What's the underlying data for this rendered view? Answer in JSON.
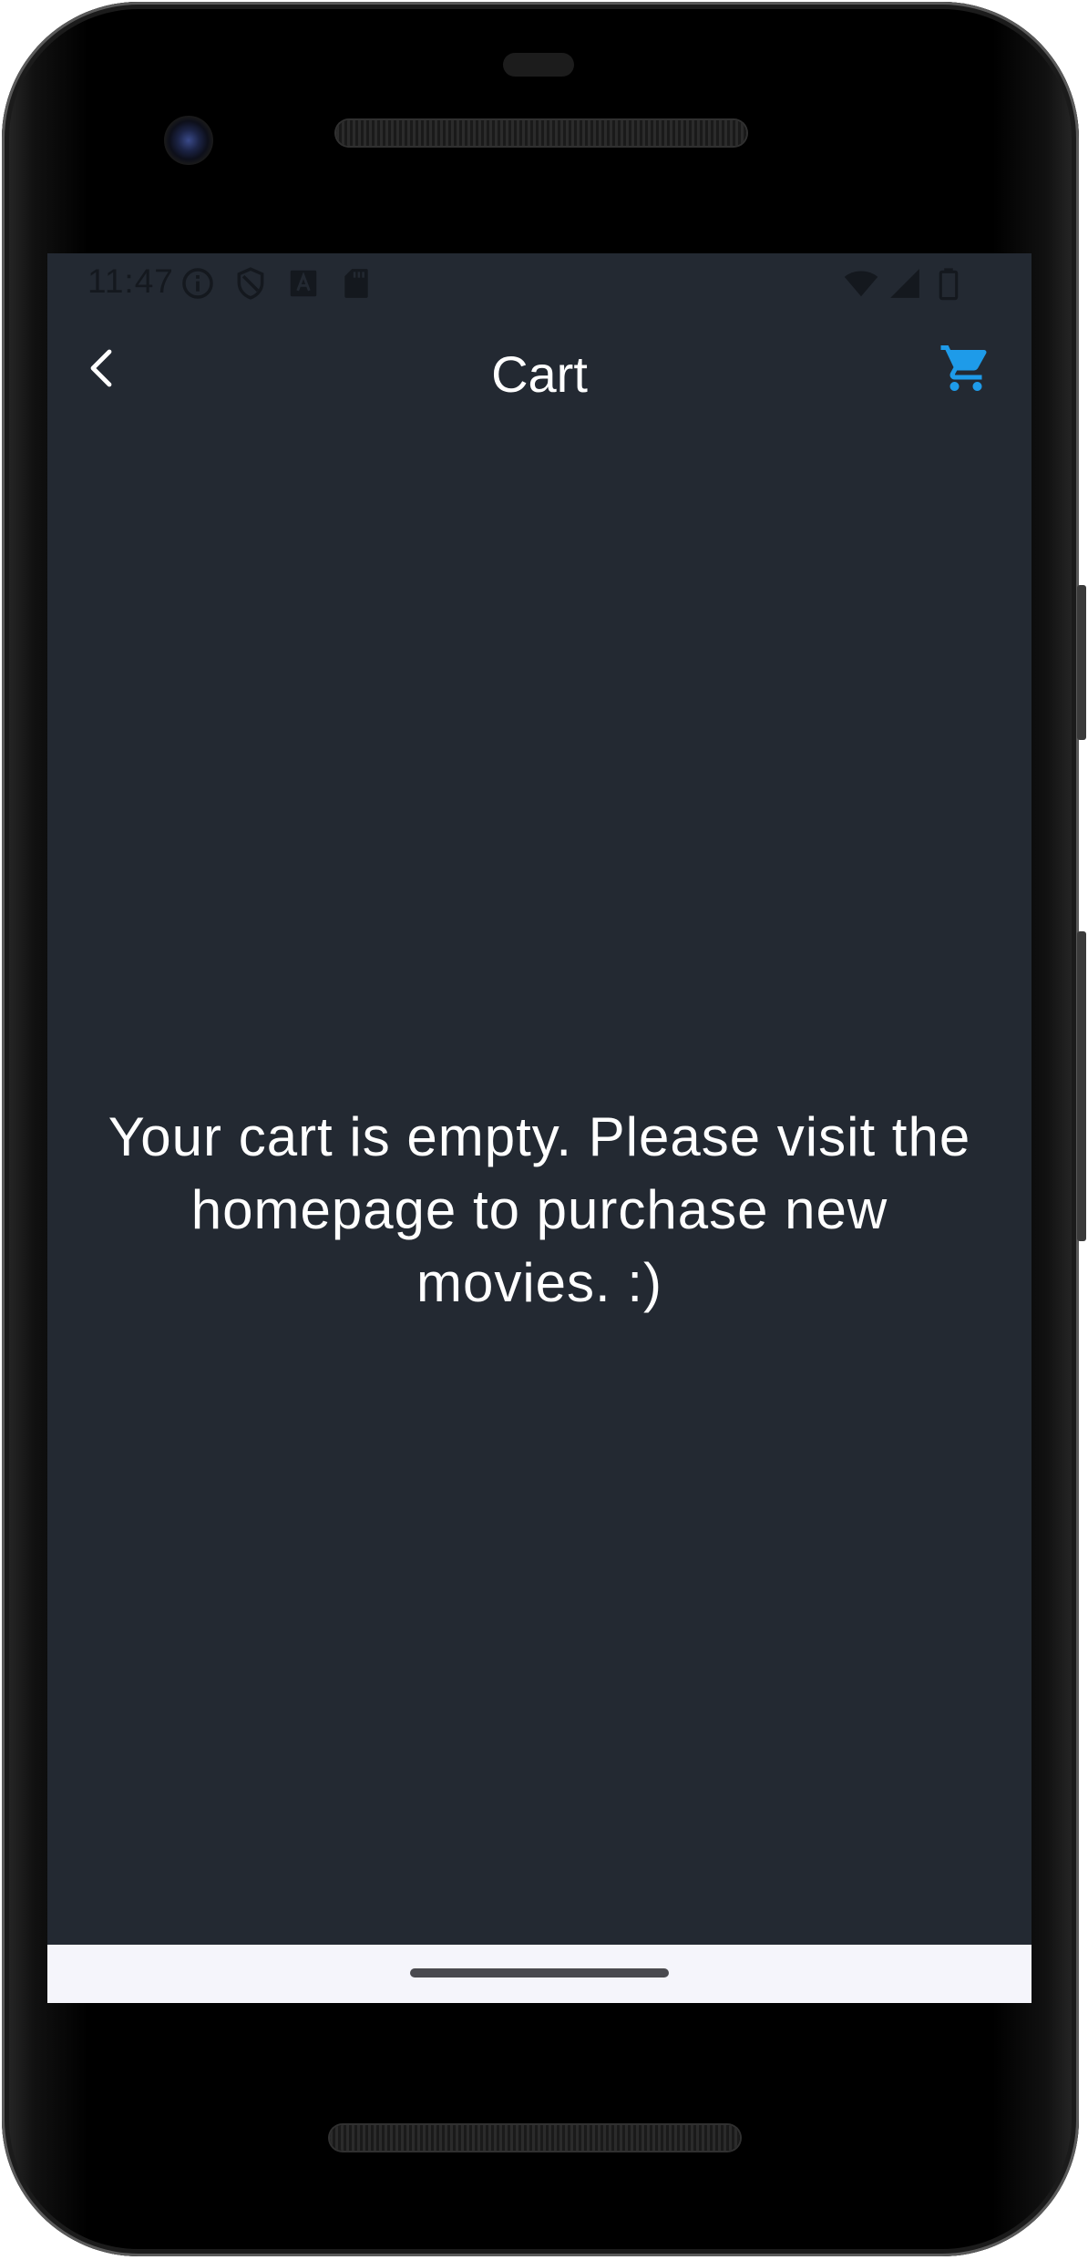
{
  "status_bar": {
    "time": "11:47",
    "left_icons": [
      "info-icon",
      "shield-icon",
      "a-icon",
      "sd-card-icon"
    ],
    "right_icons": [
      "wifi-icon",
      "signal-icon",
      "battery-icon"
    ]
  },
  "app_bar": {
    "title": "Cart",
    "back_icon": "chevron-left-icon",
    "cart_icon": "shopping-cart-icon",
    "accent_color": "#1e9be9"
  },
  "main": {
    "empty_message": "Your cart is empty. Please visit the homepage to purchase new movies. :)"
  },
  "theme": {
    "background": "#232932",
    "text": "#ffffff",
    "nav_bar": "#f5f5fb"
  }
}
